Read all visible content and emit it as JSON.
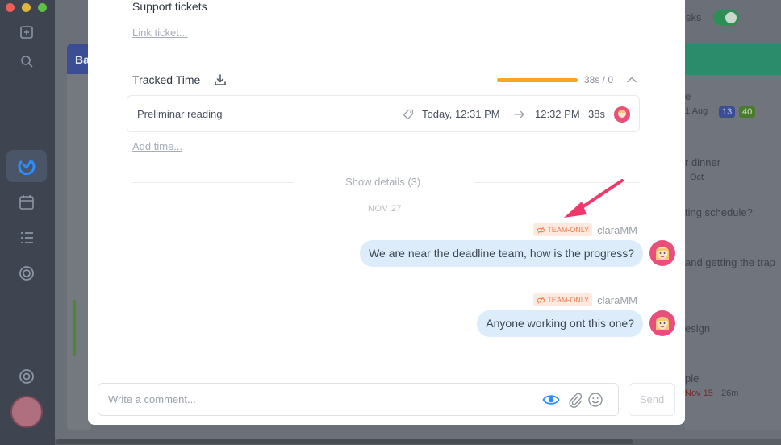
{
  "background_app": {
    "column_label": "Ba",
    "right_header_label": "sks",
    "right_items": [
      {
        "text": "e"
      },
      {
        "text": "1 Aug"
      },
      {
        "text": "r dinner"
      },
      {
        "text": "Oct"
      },
      {
        "text": "ting schedule?"
      },
      {
        "text": "and getting the trap"
      },
      {
        "text": "esign"
      },
      {
        "text": "ple"
      },
      {
        "text": "Nov 15"
      },
      {
        "text": "26m"
      }
    ],
    "badges": [
      "13",
      "40"
    ]
  },
  "ticket": {
    "support_title": "Support tickets",
    "link_ticket": "Link ticket..."
  },
  "tracked_time": {
    "title": "Tracked Time",
    "progress_fraction": 1.0,
    "progress_color": "#f5a623",
    "summary": "38s / 0",
    "entries": [
      {
        "name": "Preliminar reading",
        "start": "Today, 12:31 PM",
        "end": "12:32 PM",
        "duration": "38s"
      }
    ],
    "add_time": "Add time..."
  },
  "activity": {
    "show_details": "Show details (3)",
    "date_separator": "NOV 27",
    "messages": [
      {
        "badge": "TEAM-ONLY",
        "author": "claraMM",
        "text": "We are near the deadline team, how is the progress?"
      },
      {
        "badge": "TEAM-ONLY",
        "author": "claraMM",
        "text": "Anyone working ont this one?"
      }
    ]
  },
  "composer": {
    "placeholder": "Write a comment...",
    "send_label": "Send"
  },
  "colors": {
    "accent": "#2d8cff",
    "team_badge_bg": "#fde9df",
    "team_badge_fg": "#f07c4a",
    "bubble_bg": "#dcecfb",
    "annotation_arrow": "#f0386b"
  },
  "icons": [
    "download-icon",
    "chevron-up-icon",
    "tag-icon",
    "arrow-right-icon",
    "eye-icon",
    "paperclip-icon",
    "smiley-icon",
    "eye-slash-icon"
  ]
}
